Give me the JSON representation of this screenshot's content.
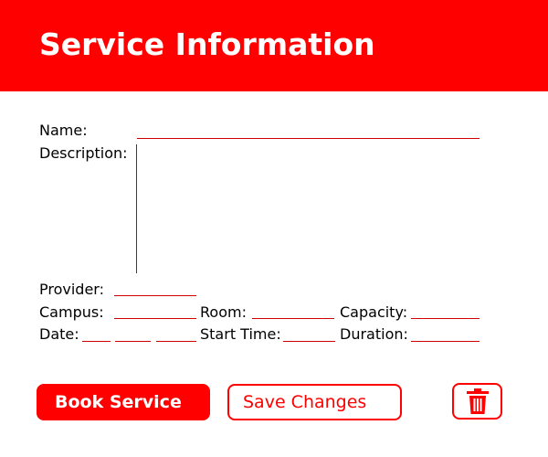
{
  "header": {
    "title": "Service Information"
  },
  "form": {
    "name_label": "Name:",
    "description_label": "Description:",
    "provider_label": "Provider:",
    "campus_label": "Campus:",
    "room_label": "Room:",
    "capacity_label": "Capacity:",
    "date_label": "Date:",
    "start_time_label": "Start Time:",
    "duration_label": "Duration:"
  },
  "actions": {
    "book_label": "Book Service",
    "save_label": "Save Changes",
    "delete_icon": "trash-icon"
  },
  "colors": {
    "accent": "#ff0000",
    "line": "#cc0000",
    "text": "#000000",
    "background": "#ffffff"
  }
}
